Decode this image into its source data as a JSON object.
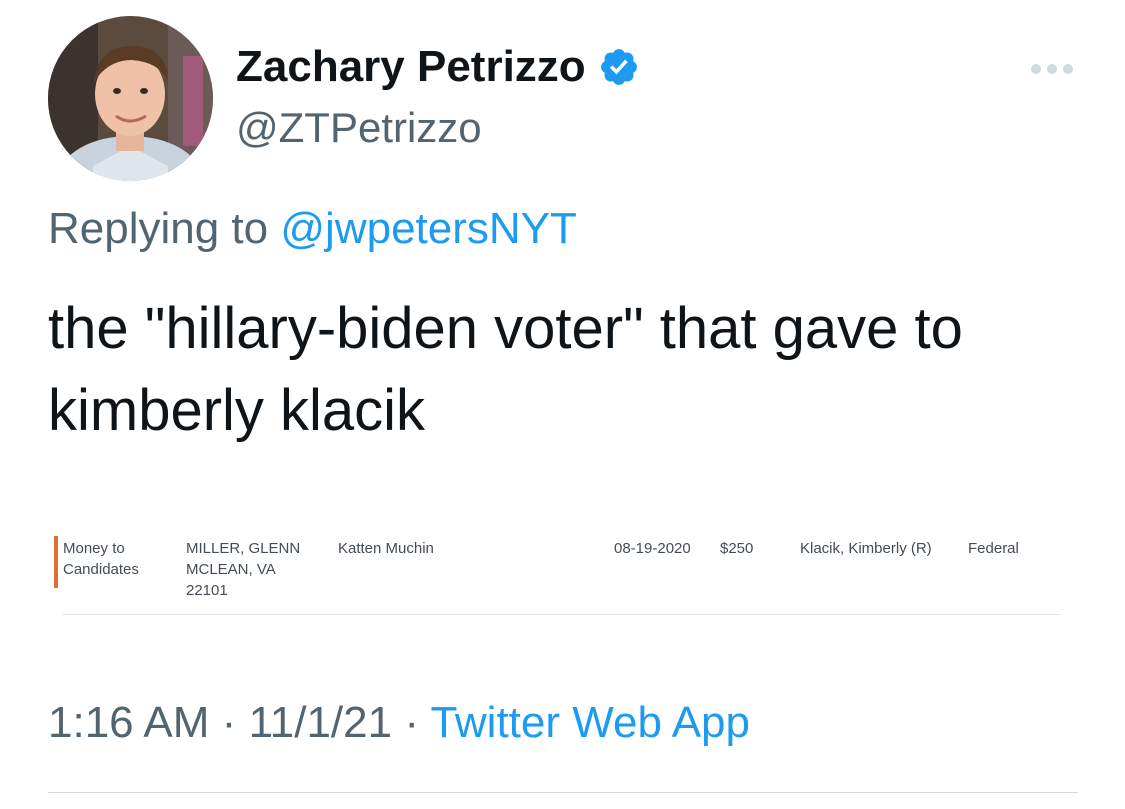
{
  "author": {
    "display_name": "Zachary Petrizzo",
    "handle": "@ZTPetrizzo",
    "verified": true
  },
  "reply": {
    "prefix": "Replying to",
    "to_handle": "@jwpetersNYT"
  },
  "tweet": {
    "text": "the \"hillary-biden voter\" that gave to kimberly klacik"
  },
  "contribution_record": {
    "type_line1": "Money to",
    "type_line2": "Candidates",
    "donor_name": "MILLER, GLENN",
    "donor_city": "MCLEAN, VA",
    "donor_zip": "22101",
    "employer": "Katten Muchin",
    "date": "08-19-2020",
    "amount": "$250",
    "recipient": "Klacik, Kimberly (R)",
    "level": "Federal"
  },
  "meta": {
    "time": "1:16 AM",
    "separator": "·",
    "date": "11/1/21",
    "source": "Twitter Web App"
  },
  "colors": {
    "link": "#1d9bf0",
    "verified": "#1d9bf0",
    "record_accent": "#e07030"
  },
  "icons": {
    "verified": "verified-badge-icon",
    "more": "more-options-icon"
  }
}
